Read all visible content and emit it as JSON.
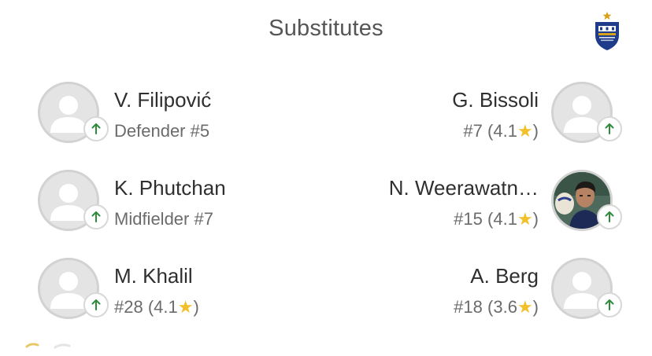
{
  "header": {
    "title": "Substitutes",
    "badge_icon": "club-crest-icon",
    "badge_colors": {
      "navy": "#1f3c8a",
      "gold": "#d7a21a"
    }
  },
  "left": [
    {
      "name": "V. Filipović",
      "position": "Defender",
      "number": "#5"
    },
    {
      "name": "K. Phutchan",
      "position": "Midfielder",
      "number": "#7"
    },
    {
      "name": "M. Khalil",
      "number": "#28",
      "rating": "(4.1",
      "star": "★",
      "rating_close": ")"
    }
  ],
  "right": [
    {
      "name": "G. Bissoli",
      "number": "#7",
      "rating": "(4.1",
      "star": "★",
      "rating_close": ")"
    },
    {
      "name": "N. Weerawatn…",
      "number": "#15",
      "rating": "(4.1",
      "star": "★",
      "rating_close": ")",
      "has_photo": true
    },
    {
      "name": "A. Berg",
      "number": "#18",
      "rating": "(3.6",
      "star": "★",
      "rating_close": ")"
    }
  ],
  "icons": {
    "substitution": "arrow-up-icon",
    "avatar_placeholder": "person-silhouette-icon"
  },
  "colors": {
    "sub_arrow": "#2e8b3d",
    "star": "#f2c029",
    "avatar_bg": "#e4e4e4",
    "avatar_border": "#d2d2d2"
  }
}
